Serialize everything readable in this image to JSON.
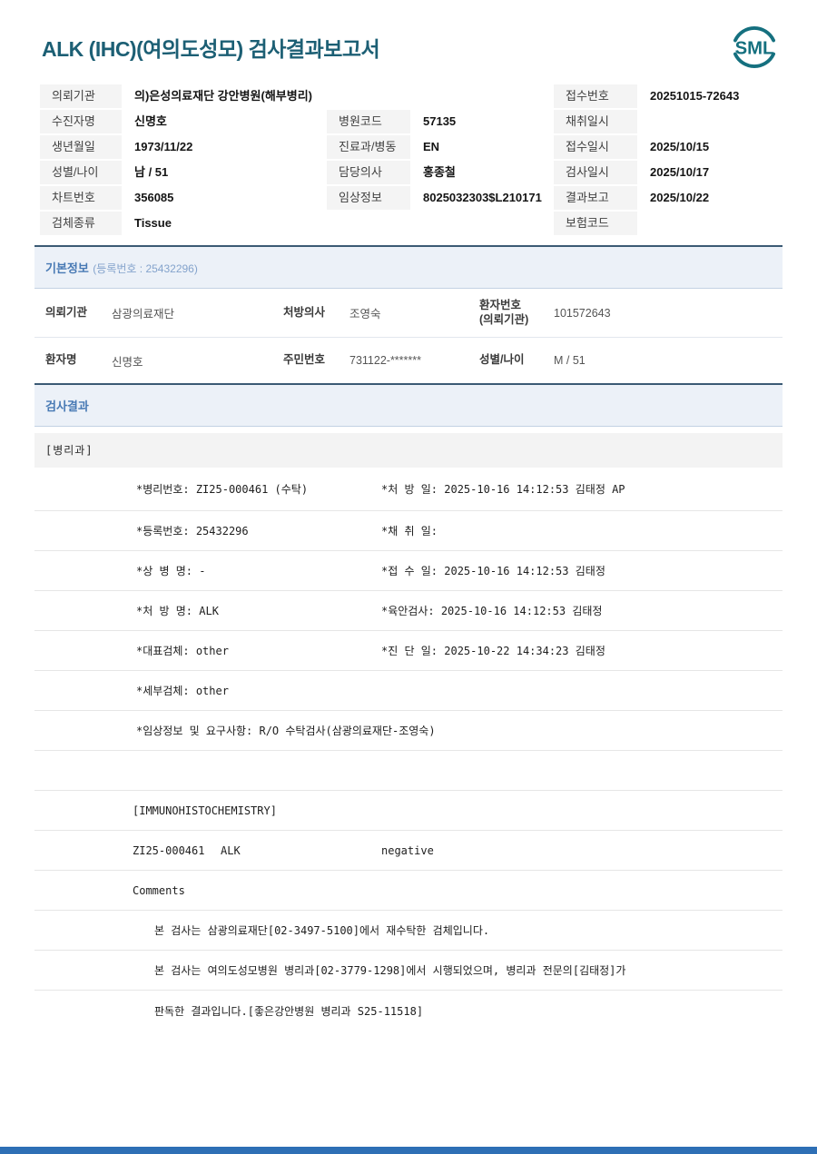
{
  "header": {
    "title": "ALK (IHC)(여의도성모) 검사결과보고서",
    "logo_text": "SML"
  },
  "colors": {
    "title_teal": "#1c5f74",
    "logo_teal": "#15707f",
    "section_blue": "#4779b4",
    "divider_navy": "#3b5a74",
    "footer_blue": "#2e6fb5"
  },
  "info_table": {
    "r1": {
      "l1": "의뢰기관",
      "v1": "의)은성의료재단 강안병원(해부병리)",
      "l3": "접수번호",
      "v3": "20251015-72643"
    },
    "r2": {
      "l1": "수진자명",
      "v1": "신명호",
      "l2": "병원코드",
      "v2": "57135",
      "l3": "채취일시",
      "v3": ""
    },
    "r3": {
      "l1": "생년월일",
      "v1": "1973/11/22",
      "l2": "진료과/병동",
      "v2": "EN",
      "l3": "접수일시",
      "v3": "2025/10/15"
    },
    "r4": {
      "l1": "성별/나이",
      "v1": "남 / 51",
      "l2": "담당의사",
      "v2": "홍종철",
      "l3": "검사일시",
      "v3": "2025/10/17"
    },
    "r5": {
      "l1": "차트번호",
      "v1": "356085",
      "l2": "임상정보",
      "v2": "8025032303$L210171",
      "l3": "결과보고",
      "v3": "2025/10/22"
    },
    "r6": {
      "l1": "검체종류",
      "v1": "Tissue",
      "l3": "보험코드",
      "v3": ""
    }
  },
  "basic_info": {
    "title": "기본정보",
    "reg_no": "(등록번호 : 25432296)",
    "r1": {
      "l1": "의뢰기관",
      "v1": "삼광의료재단",
      "l2": "처방의사",
      "v2": "조영숙",
      "l3a": "환자번호",
      "l3b": "(의뢰기관)",
      "v3": "101572643"
    },
    "r2": {
      "l1": "환자명",
      "v1": "신명호",
      "l2": "주민번호",
      "v2": "731122-*******",
      "l3": "성별/나이",
      "v3": "M / 51"
    }
  },
  "results": {
    "title": "검사결과",
    "dept": "[병리과]",
    "rows": [
      {
        "left": "*병리번호: ZI25-000461 (수탁)",
        "right": "*처 방 일: 2025-10-16 14:12:53  김태정 AP"
      },
      {
        "left": "*등록번호: 25432296",
        "right": "*채 취 일:"
      },
      {
        "left": "*상 병 명: -",
        "right": "*접 수 일: 2025-10-16 14:12:53  김태정"
      },
      {
        "left": "*처 방 명: ALK",
        "right": "*육안검사: 2025-10-16 14:12:53  김태정"
      },
      {
        "left": "*대표검체: other",
        "right": "*진 단 일: 2025-10-22 14:34:23  김태정"
      },
      {
        "left": "*세부검체: other",
        "right": ""
      },
      {
        "full": "*임상정보 및 요구사항: R/O 수탁검사(삼광의료재단-조영숙)"
      },
      {
        "full": ""
      },
      {
        "full": "[IMMUNOHISTOCHEMISTRY]"
      },
      {
        "c1": "ZI25-000461",
        "c2": "ALK",
        "c3": "negative"
      },
      {
        "full": "Comments"
      },
      {
        "full": "본 검사는 삼광의료재단[02-3497-5100]에서 재수탁한 검체입니다."
      },
      {
        "full": "본 검사는 여의도성모병원 병리과[02-3779-1298]에서 시행되었으며, 병리과 전문의[김태정]가"
      },
      {
        "full": "판독한 결과입니다.[좋은강안병원 병리과 S25-11518]"
      }
    ]
  }
}
